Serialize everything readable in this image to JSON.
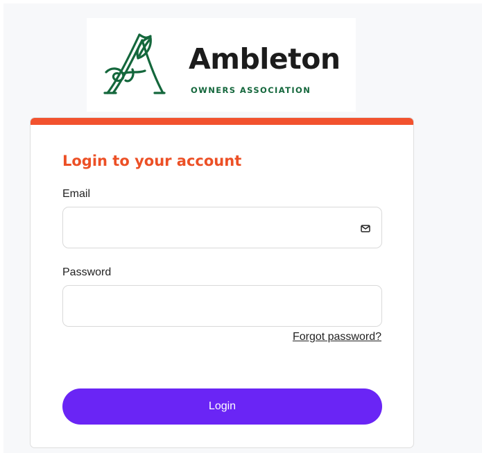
{
  "logo": {
    "name": "Ambleton",
    "subtitle": "OWNERS ASSOCIATION",
    "emblem_icon": "ambleton-emblem-icon",
    "name_color": "#1c1c1c",
    "subtitle_color": "#14673c"
  },
  "login": {
    "title": "Login to your account",
    "email_label": "Email",
    "email_value": "",
    "email_icon": "envelope-icon",
    "password_label": "Password",
    "password_value": "",
    "forgot_password": "Forgot password?",
    "submit_label": "Login"
  },
  "colors": {
    "accent_bar": "#f2522e",
    "title": "#ec5026",
    "button": "#6a25f5",
    "page_background": "#f7f8fa"
  }
}
